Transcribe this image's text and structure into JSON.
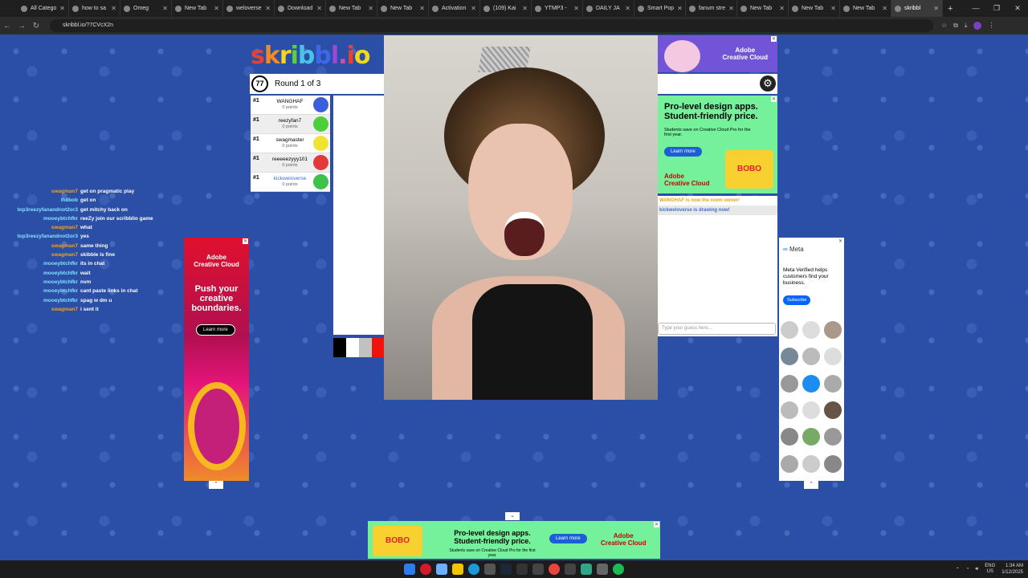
{
  "browser": {
    "tabs": [
      {
        "label": "All Catego"
      },
      {
        "label": "how to sa"
      },
      {
        "label": "Omeg"
      },
      {
        "label": "New Tab"
      },
      {
        "label": "weloverse"
      },
      {
        "label": "Download"
      },
      {
        "label": "New Tab"
      },
      {
        "label": "New Tab"
      },
      {
        "label": "Activation"
      },
      {
        "label": "(109) Kai"
      },
      {
        "label": "YTMP3 -"
      },
      {
        "label": "DAILY JA"
      },
      {
        "label": "Smart Pop"
      },
      {
        "label": "fanum stre"
      },
      {
        "label": "New Tab"
      },
      {
        "label": "New Tab"
      },
      {
        "label": "New Tab"
      },
      {
        "label": "skribbl"
      }
    ],
    "new_tab": "+",
    "url": "skribbl.io/?7CVcX2n",
    "win_minimize": "—",
    "win_restore": "❐",
    "win_close": "✕"
  },
  "game": {
    "logo": [
      "s",
      "k",
      "r",
      "i",
      "b",
      "b",
      "l",
      ".",
      "i",
      "o"
    ],
    "timer": "77",
    "round": "Round 1 of 3",
    "players": [
      {
        "rank": "#1",
        "name": "WANGHAF",
        "points": "0 points",
        "color": "#3a5fd8"
      },
      {
        "rank": "#1",
        "name": "reezyfan7",
        "points": "0 points",
        "color": "#4ccf3a"
      },
      {
        "rank": "#1",
        "name": "swagmaster",
        "points": "0 points",
        "color": "#f1e334"
      },
      {
        "rank": "#1",
        "name": "reeeeezyyy101",
        "points": "0 points",
        "color": "#e23a3a"
      },
      {
        "rank": "#1",
        "name": "kickweloverse",
        "points": "0 points",
        "color": "#3ec24a"
      }
    ],
    "chat": [
      {
        "text": "WANGHAF is now the room owner!",
        "style": "a"
      },
      {
        "text": "kickweloverse is drawing now!",
        "style": "b"
      }
    ],
    "guess_placeholder": "Type your guess here...",
    "palette": [
      "#000000",
      "#ffffff",
      "#c1c1c1",
      "#ef130b"
    ]
  },
  "left_chat": [
    {
      "user": "swagman7",
      "msg": "get on pragmatic play",
      "color": "#f0a31a"
    },
    {
      "user": "lh8bob",
      "msg": "get on",
      "color": "#7fe3ff"
    },
    {
      "user": "top3reezyfanandnot2or3",
      "msg": "get mitchy back on",
      "color": "#7fe3ff"
    },
    {
      "user": "mooeybtchfkr",
      "msg": "reeZy join our scribblio game",
      "color": "#7fe3ff"
    },
    {
      "user": "swagman7",
      "msg": "what",
      "color": "#f0a31a"
    },
    {
      "user": "top3reezyfanandnot2or3",
      "msg": "yes",
      "color": "#7fe3ff"
    },
    {
      "user": "swagman7",
      "msg": "same thing",
      "color": "#f0a31a"
    },
    {
      "user": "swagman7",
      "msg": "skibble is fine",
      "color": "#f0a31a"
    },
    {
      "user": "mooeybtchfkr",
      "msg": "its in chat",
      "color": "#7fe3ff"
    },
    {
      "user": "mooeybtchfkr",
      "msg": "wait",
      "color": "#7fe3ff"
    },
    {
      "user": "mooeybtchfkr",
      "msg": "nvm",
      "color": "#7fe3ff"
    },
    {
      "user": "mooeybtchfkr",
      "msg": "cant paste links in chat",
      "color": "#7fe3ff"
    },
    {
      "user": "mooeybtchfkr",
      "msg": "spag w dm u",
      "color": "#7fe3ff"
    },
    {
      "user": "swagman7",
      "msg": "i sent it",
      "color": "#f0a31a"
    }
  ],
  "ads": {
    "top_right_brand": "Adobe\nCreative Cloud",
    "cc_headline": "Pro-level design apps. Student-friendly price.",
    "cc_sub": "Students save on Creative Cloud Pro for the first year.",
    "cc_learn": "Learn more",
    "cc_brand": "Adobe\nCreative Cloud",
    "left_brand": "Adobe\nCreative Cloud",
    "left_headline": "Push your creative boundaries.",
    "left_learn": "Learn more",
    "meta_brand": "Meta",
    "meta_text": "Meta Verified helps customers find your business.",
    "meta_subscribe": "Subscribe",
    "bottom_headline": "Pro-level design apps. Student-friendly price.",
    "bottom_sub": "Students save on Creative Cloud Pro for the first year.",
    "bottom_learn": "Learn more",
    "bottom_brand": "Adobe\nCreative Cloud",
    "bobo": "BOBO"
  },
  "taskbar": {
    "lang": "ENG\nUS",
    "time": "1:34 AM",
    "date": "1/12/2025"
  }
}
